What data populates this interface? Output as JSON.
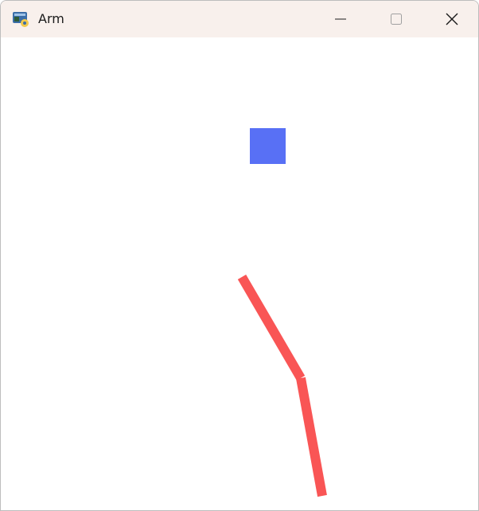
{
  "window": {
    "title": "Arm",
    "icon": "python-app-icon"
  },
  "controls": [
    {
      "name": "minimize-button",
      "icon": "minimize-icon"
    },
    {
      "name": "maximize-button",
      "icon": "maximize-icon"
    },
    {
      "name": "close-button",
      "icon": "close-icon"
    }
  ],
  "scene": {
    "background_color": "#ffffff",
    "target_color": "#5870f5",
    "arm_color": "#f95555"
  }
}
